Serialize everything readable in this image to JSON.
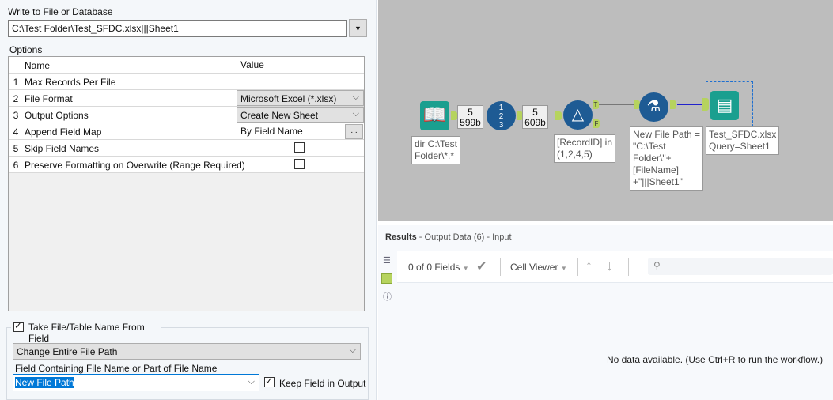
{
  "config": {
    "write_label": "Write to File or Database",
    "path_value": "C:\\Test Folder\\Test_SFDC.xlsx|||Sheet1",
    "options_label": "Options",
    "grid_headers": {
      "name": "Name",
      "value": "Value"
    },
    "rows": [
      {
        "num": "1",
        "name": "Max Records Per File",
        "value": ""
      },
      {
        "num": "2",
        "name": "File Format",
        "value": "Microsoft Excel (*.xlsx)"
      },
      {
        "num": "3",
        "name": "Output Options",
        "value": "Create New Sheet"
      },
      {
        "num": "4",
        "name": "Append Field Map",
        "value": "By Field Name",
        "button": "..."
      },
      {
        "num": "5",
        "name": "Skip Field Names",
        "checked": false
      },
      {
        "num": "6",
        "name": "Preserve Formatting on Overwrite (Range Required)",
        "checked": false
      }
    ],
    "take_name_label": "Take File/Table Name From Field",
    "take_name_checked": true,
    "mode_value": "Change Entire File Path",
    "field_label": "Field Containing File Name or Part of File Name",
    "field_value": "New File Path",
    "keep_field_label": "Keep Field in Output",
    "keep_field_checked": true
  },
  "canvas": {
    "count1": {
      "records": "5",
      "size": "599b"
    },
    "count2": {
      "records": "5",
      "size": "609b"
    },
    "input_annotation": "dir C:\\Test\nFolder\\*.*",
    "filter_annotation": "[RecordID] in\n(1,2,4,5)",
    "formula_annotation": "New File Path =\n\"C:\\Test\nFolder\\\"+\n[FileName]\n+\"|||Sheet1\"",
    "output_annotation": "Test_SFDC.xlsx\nQuery=Sheet1",
    "anchor_t": "T",
    "anchor_f": "F",
    "recordid_digits": [
      "1",
      "2",
      "3"
    ]
  },
  "results": {
    "title": "Results",
    "subtitle": " - Output Data (6) - Input",
    "fields": "0 of 0 Fields",
    "cell_viewer": "Cell Viewer",
    "empty": "No data available. (Use Ctrl+R to run the workflow.)"
  },
  "colors": {
    "tool_blue": "#1e5b94",
    "tool_teal": "#1a9f8f",
    "anchor": "#b6d35e"
  }
}
